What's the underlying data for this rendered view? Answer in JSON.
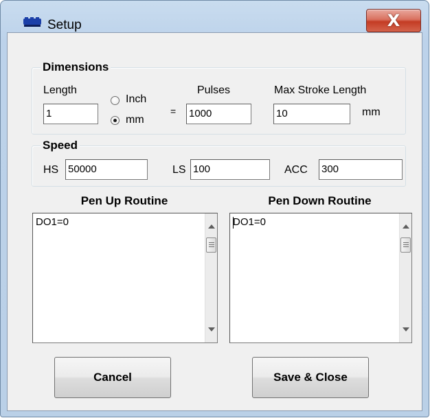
{
  "window": {
    "title": "Setup",
    "icon": "app-connectors-icon",
    "close_glyph": "X"
  },
  "dimensions": {
    "legend": "Dimensions",
    "length_label": "Length",
    "length_value": "1",
    "unit_inch_label": "Inch",
    "unit_mm_label": "mm",
    "selected_unit": "mm",
    "equals": "=",
    "pulses_label": "Pulses",
    "pulses_value": "1000",
    "max_stroke_label": "Max Stroke Length",
    "max_stroke_value": "10",
    "max_stroke_unit": "mm"
  },
  "speed": {
    "legend": "Speed",
    "hs_label": "HS",
    "hs_value": "50000",
    "ls_label": "LS",
    "ls_value": "100",
    "acc_label": "ACC",
    "acc_value": "300"
  },
  "pen_up": {
    "heading": "Pen Up Routine",
    "text": "DO1=0"
  },
  "pen_down": {
    "heading": "Pen Down Routine",
    "text": "DO1=0"
  },
  "buttons": {
    "cancel": "Cancel",
    "save_close": "Save & Close"
  },
  "colors": {
    "frame": "#bcd2ea",
    "client": "#f0f0f0",
    "close_button": "#c43c24"
  }
}
